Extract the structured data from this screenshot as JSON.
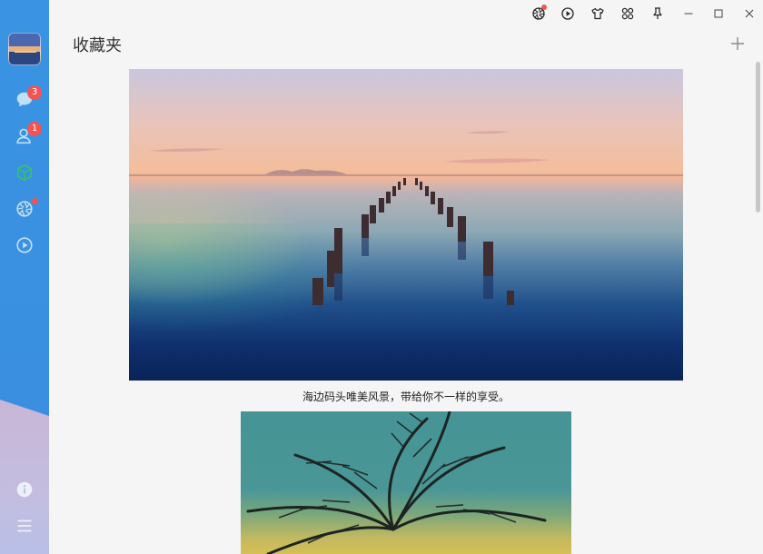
{
  "sidebar": {
    "avatar_icon": "user-avatar",
    "items": [
      {
        "icon": "chat-bubble-icon",
        "badge": "3"
      },
      {
        "icon": "contacts-icon",
        "badge": "1"
      },
      {
        "icon": "cube-icon"
      },
      {
        "icon": "aperture-icon"
      },
      {
        "icon": "play-circle-icon"
      }
    ],
    "bottom": [
      {
        "icon": "info-icon"
      },
      {
        "icon": "menu-icon"
      }
    ],
    "accent": "#3a93e3",
    "active_color": "#34c26d"
  },
  "titlebar": {
    "buttons": [
      "aperture-icon",
      "play-circle-icon",
      "tshirt-icon",
      "apps-grid-icon",
      "pin-icon",
      "minimize-icon",
      "maximize-icon",
      "close-icon"
    ]
  },
  "header": {
    "title": "收藏夹",
    "add_icon": "plus-icon"
  },
  "main": {
    "items": [
      {
        "type": "image",
        "caption": "海边码头唯美风景，带给你不一样的享受。"
      },
      {
        "type": "image",
        "caption": ""
      }
    ]
  },
  "colors": {
    "badge": "#f5534f",
    "background": "#f5f5f5"
  }
}
